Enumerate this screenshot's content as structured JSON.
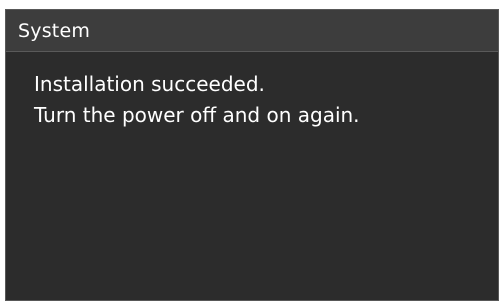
{
  "dialog": {
    "title": "System",
    "message_lines": [
      "Installation succeeded.",
      "Turn the power off and on again."
    ]
  }
}
